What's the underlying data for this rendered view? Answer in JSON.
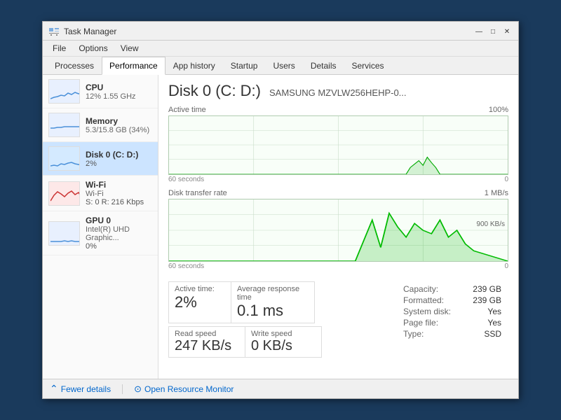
{
  "window": {
    "title": "Task Manager",
    "controls": {
      "minimize": "—",
      "maximize": "□",
      "close": "✕"
    }
  },
  "menu": {
    "items": [
      "File",
      "Options",
      "View"
    ]
  },
  "tabs": [
    {
      "id": "processes",
      "label": "Processes"
    },
    {
      "id": "performance",
      "label": "Performance",
      "active": true
    },
    {
      "id": "app-history",
      "label": "App history"
    },
    {
      "id": "startup",
      "label": "Startup"
    },
    {
      "id": "users",
      "label": "Users"
    },
    {
      "id": "details",
      "label": "Details"
    },
    {
      "id": "services",
      "label": "Services"
    }
  ],
  "left_panel": {
    "items": [
      {
        "id": "cpu",
        "name": "CPU",
        "sub": "12% 1.55 GHz",
        "pct": "",
        "chart_type": "cpu",
        "selected": false
      },
      {
        "id": "memory",
        "name": "Memory",
        "sub": "5.3/15.8 GB (34%)",
        "pct": "",
        "chart_type": "memory",
        "selected": false
      },
      {
        "id": "disk",
        "name": "Disk 0 (C: D:)",
        "sub": "",
        "pct": "2%",
        "chart_type": "disk",
        "selected": true
      },
      {
        "id": "wifi",
        "name": "Wi-Fi",
        "sub": "Wi-Fi",
        "pct": "S: 0  R: 216 Kbps",
        "chart_type": "wifi",
        "selected": false
      },
      {
        "id": "gpu",
        "name": "GPU 0",
        "sub": "Intel(R) UHD Graphic...",
        "pct": "0%",
        "chart_type": "gpu",
        "selected": false
      }
    ]
  },
  "right_panel": {
    "title": "Disk 0 (C: D:)",
    "model": "SAMSUNG MZVLW256HEHP-0...",
    "active_time_chart": {
      "label": "Active time",
      "max_label": "100%",
      "time_label_left": "60 seconds",
      "time_label_right": "0"
    },
    "transfer_chart": {
      "label": "Disk transfer rate",
      "max_label": "1 MB/s",
      "secondary_label": "900 KB/s",
      "time_label_left": "60 seconds",
      "time_label_right": "0"
    },
    "stats": {
      "active_time_label": "Active time:",
      "active_time_value": "2%",
      "avg_response_label": "Average response time",
      "avg_response_value": "0.1 ms",
      "read_speed_label": "Read speed",
      "read_speed_value": "247 KB/s",
      "write_speed_label": "Write speed",
      "write_speed_value": "0 KB/s",
      "capacity_label": "Capacity:",
      "capacity_value": "239 GB",
      "formatted_label": "Formatted:",
      "formatted_value": "239 GB",
      "system_disk_label": "System disk:",
      "system_disk_value": "Yes",
      "page_file_label": "Page file:",
      "page_file_value": "Yes",
      "type_label": "Type:",
      "type_value": "SSD"
    }
  },
  "bottom_bar": {
    "fewer_details_label": "Fewer details",
    "resource_monitor_label": "Open Resource Monitor"
  }
}
